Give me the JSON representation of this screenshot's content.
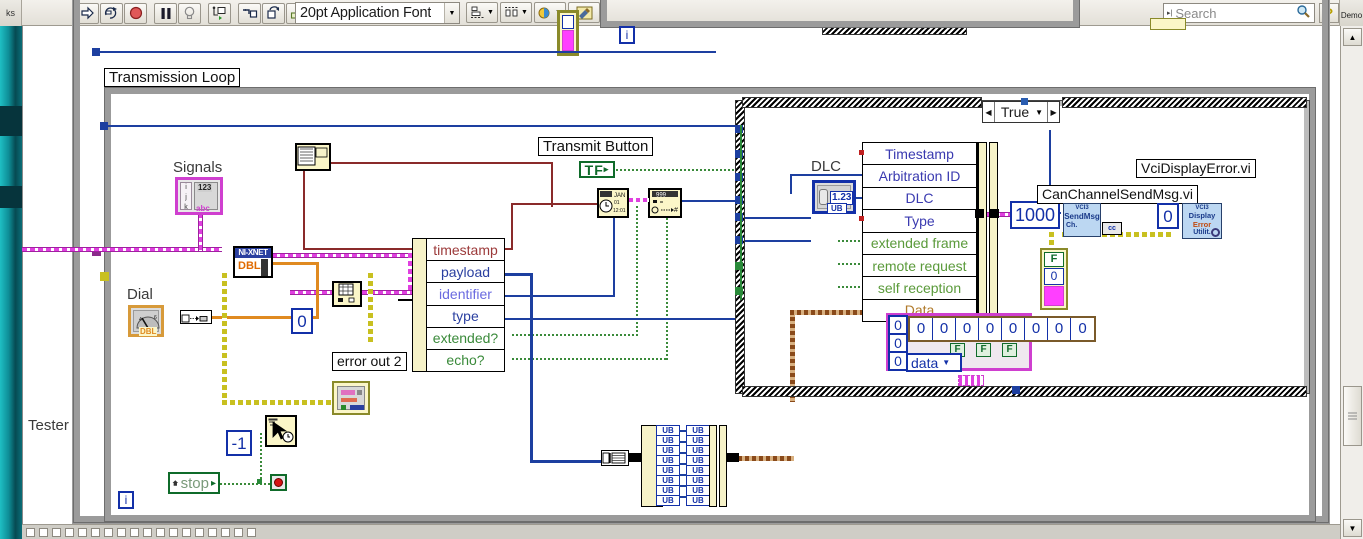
{
  "toolbar": {
    "run_label": "run-arrow",
    "run_continuous_label": "run-continuous",
    "abort_label": "abort-execution",
    "pause_label": "pause",
    "highlight_label": "highlight-execution",
    "step_into_label": "step-into",
    "step_over_label": "step-over",
    "step_out_label": "step-out",
    "retain_values_label": "retain-wire-values",
    "font": "20pt Application Font",
    "align_objects": "align-objects",
    "distribute_objects": "distribute-objects",
    "reorder": "reorder",
    "clean_diagram": "clean-up-diagram",
    "search_placeholder": "Search",
    "help_label": "?",
    "left_tab": "ks",
    "right_tab": "Demo"
  },
  "canvas": {
    "tester_label": "Tester",
    "transmission_loop_label": "Transmission Loop",
    "signals_label": "Signals",
    "dial_label": "Dial",
    "error_out_label": "error out 2",
    "transmit_button_label": "Transmit Button",
    "dlc_label": "DLC",
    "can_send_vi_label": "CanChannelSendMsg.vi",
    "vci_display_error_label": "VciDisplayError.vi",
    "case_selector_value": "True",
    "iteration_label": "i",
    "stop_label": "stop",
    "wait_constant": "-1",
    "zero_constant": "0",
    "timeout_constant": "1000",
    "error_code_constant": "0",
    "xnet_label": "NI-XNET",
    "xnet_type": "DBL",
    "signals_type": "abc",
    "signals_numeric": "123",
    "dlc_value": "1.23",
    "dlc_type": "UB",
    "dbl_dial_type": "DBL",
    "data_dropdown": "data",
    "data_values": [
      "0",
      "0",
      "0",
      "0",
      "0",
      "0",
      "0",
      "0"
    ],
    "data_index_values": [
      "0",
      "0",
      "0"
    ],
    "flag_labels": [
      "F",
      "F",
      "F"
    ],
    "ub_left_count": 9,
    "ub_right_count": 8,
    "ub_label": "UB",
    "vci_send_icon_lines": [
      "VCI3",
      "SendMsg",
      "Ch."
    ],
    "vci_error_icon_lines": [
      "VCI3",
      "Display",
      "Error",
      "Utilit."
    ]
  },
  "unbundle": {
    "fields": [
      {
        "name": "timestamp",
        "color": "#9c3a3a"
      },
      {
        "name": "payload",
        "color": "#2a3fa0"
      },
      {
        "name": "identifier",
        "color": "#6a6ae0"
      },
      {
        "name": "type",
        "color": "#2a3fa0"
      },
      {
        "name": "extended?",
        "color": "#3a8a3a"
      },
      {
        "name": "echo?",
        "color": "#3a8a3a"
      }
    ]
  },
  "bundle": {
    "fields": [
      {
        "name": "Timestamp",
        "color": "#3a3ab0"
      },
      {
        "name": "Arbitration ID",
        "color": "#3a3ab0"
      },
      {
        "name": "DLC",
        "color": "#3a3ab0"
      },
      {
        "name": "Type",
        "color": "#3a3ab0"
      },
      {
        "name": "extended frame",
        "color": "#5a9a3a"
      },
      {
        "name": "remote request",
        "color": "#5a9a3a"
      },
      {
        "name": "self reception",
        "color": "#5a9a3a"
      },
      {
        "name": "Data",
        "color": "#b07a2a"
      }
    ]
  },
  "colors": {
    "wire_blue": "#1d3fa0",
    "wire_pink": "#e040e0",
    "wire_green": "#3a8a3a",
    "wire_brown": "#8a4a1a",
    "wire_orange": "#e08a20",
    "wire_yellow": "#c8c020",
    "wire_dark_red": "#8a2a2a",
    "loop_gray": "#9b9b9b"
  }
}
